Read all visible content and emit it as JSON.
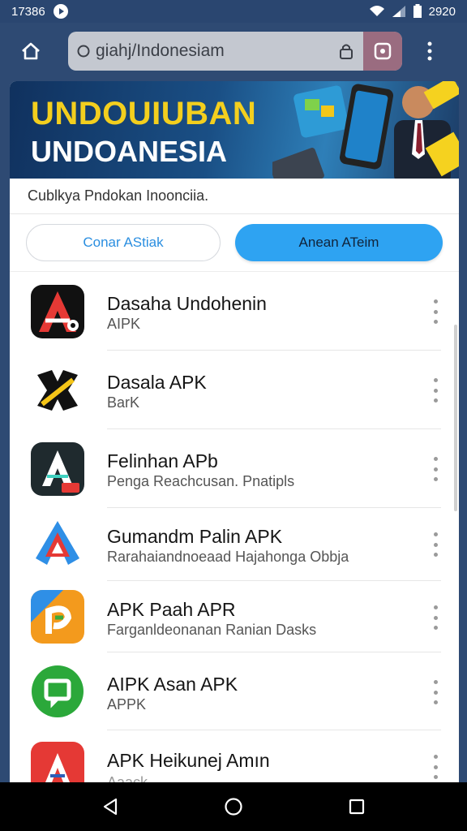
{
  "status_bar": {
    "time": "17386",
    "right_time": "2920"
  },
  "browser": {
    "url": "giahj/Indonesiam"
  },
  "banner": {
    "title_line1": "UNDOUIUBAN",
    "title_line2": "UNDOANESIA"
  },
  "subtitle": "Cublkya Pndokan Inoonciia.",
  "buttons": {
    "left": "Conar AStiak",
    "right": "Anean ATeim"
  },
  "apps": [
    {
      "name": "Dasaha Undohenin",
      "desc": "AIPK",
      "icon": "app-icon-a-red"
    },
    {
      "name": "Dasala APK",
      "desc": "BarK",
      "icon": "app-icon-x-black"
    },
    {
      "name": "Felinhan APb",
      "desc": "Penga Reachcusan. Pnatipls",
      "icon": "app-icon-a-teal"
    },
    {
      "name": "Gumandm Palin APK",
      "desc": "Rarahaiandnoeaad Hajahonga Obbja",
      "icon": "app-icon-a-blue"
    },
    {
      "name": "APK Paah APR",
      "desc": "Farganldeonanan Ranian Dasks",
      "icon": "app-icon-orange"
    },
    {
      "name": "AIPK Asan APK",
      "desc": "APPK",
      "icon": "app-icon-green-chat"
    },
    {
      "name": "APK Heikunej Amın",
      "desc": "Aaack",
      "icon": "app-icon-a-red2"
    }
  ],
  "colors": {
    "accent": "#2ea3f2",
    "banner_yellow": "#f3cf1e",
    "header_bg": "#2e4a73"
  }
}
